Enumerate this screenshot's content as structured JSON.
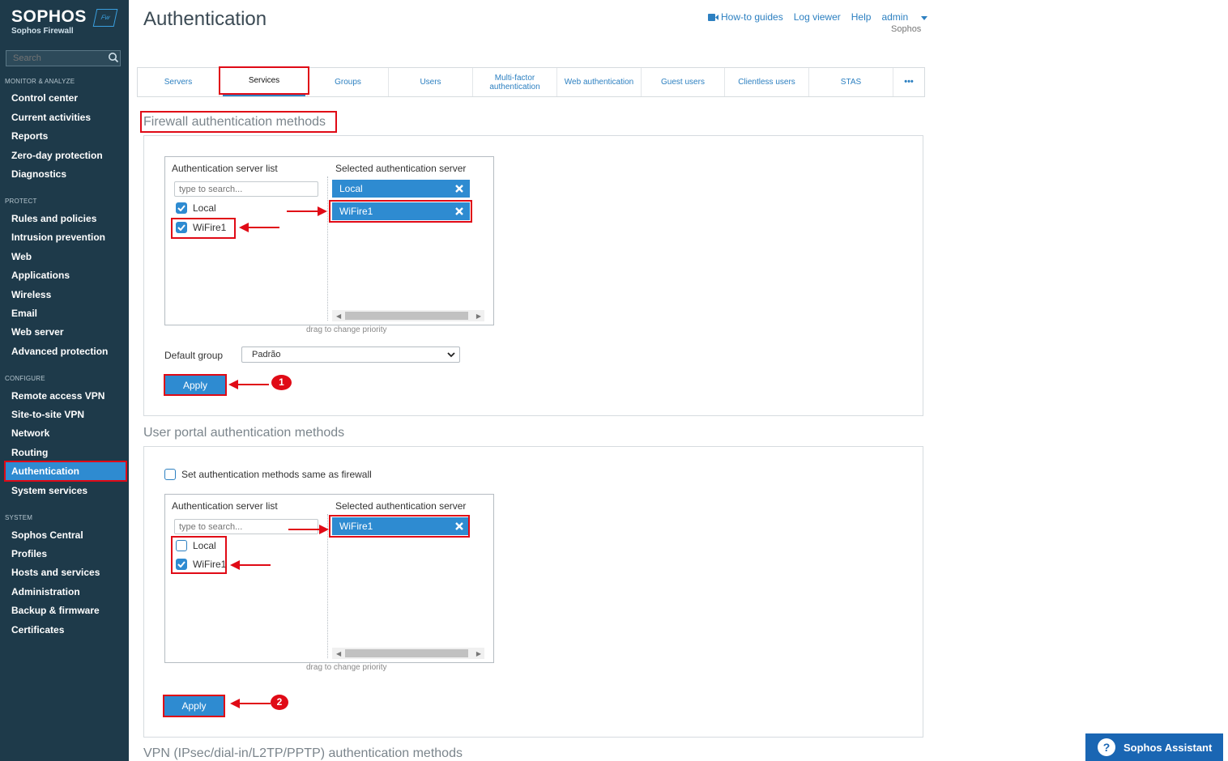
{
  "sidebar": {
    "brand": "SOPHOS",
    "brand_badge": "Fw",
    "product": "Sophos Firewall",
    "search_placeholder": "Search",
    "sections": [
      {
        "title": "MONITOR & ANALYZE",
        "items": [
          "Control center",
          "Current activities",
          "Reports",
          "Zero-day protection",
          "Diagnostics"
        ]
      },
      {
        "title": "PROTECT",
        "items": [
          "Rules and policies",
          "Intrusion prevention",
          "Web",
          "Applications",
          "Wireless",
          "Email",
          "Web server",
          "Advanced protection"
        ]
      },
      {
        "title": "CONFIGURE",
        "items": [
          "Remote access VPN",
          "Site-to-site VPN",
          "Network",
          "Routing",
          "Authentication",
          "System services"
        ]
      },
      {
        "title": "SYSTEM",
        "items": [
          "Sophos Central",
          "Profiles",
          "Hosts and services",
          "Administration",
          "Backup & firmware",
          "Certificates"
        ]
      }
    ],
    "active_item": "Authentication"
  },
  "header": {
    "title": "Authentication",
    "links": {
      "howto": "How-to guides",
      "logviewer": "Log viewer",
      "help": "Help",
      "admin": "admin"
    },
    "admin_org": "Sophos"
  },
  "tabs": [
    {
      "label": "Servers"
    },
    {
      "label": "Services"
    },
    {
      "label": "Groups"
    },
    {
      "label": "Users"
    },
    {
      "label": "Multi-factor authentication"
    },
    {
      "label": "Web authentication"
    },
    {
      "label": "Guest users"
    },
    {
      "label": "Clientless users"
    },
    {
      "label": "STAS"
    },
    {
      "label": "•••"
    }
  ],
  "firewall": {
    "title": "Firewall authentication methods",
    "server_list_title": "Authentication server list",
    "selected_title": "Selected authentication server",
    "search_placeholder": "type to search...",
    "servers": [
      {
        "name": "Local",
        "checked": true
      },
      {
        "name": "WiFire1",
        "checked": true
      }
    ],
    "selected": [
      "Local",
      "WiFire1"
    ],
    "hint": "drag to change priority",
    "default_group_label": "Default group",
    "default_group_value": "Padrão",
    "apply_label": "Apply",
    "step": "1"
  },
  "userportal": {
    "title": "User portal authentication methods",
    "same_as_firewall_label": "Set authentication methods same as firewall",
    "same_as_firewall_checked": false,
    "server_list_title": "Authentication server list",
    "selected_title": "Selected authentication server",
    "search_placeholder": "type to search...",
    "servers": [
      {
        "name": "Local",
        "checked": false
      },
      {
        "name": "WiFire1",
        "checked": true
      }
    ],
    "selected": [
      "WiFire1"
    ],
    "hint": "drag to change priority",
    "apply_label": "Apply",
    "step": "2"
  },
  "vpn": {
    "title": "VPN (IPsec/dial-in/L2TP/PPTP) authentication methods"
  },
  "assistant": {
    "label": "Sophos Assistant",
    "icon_glyph": "?"
  },
  "colors": {
    "sidebar_bg": "#1e3a4a",
    "accent": "#2e8bd1",
    "link": "#2d80c1",
    "highlight_red": "#e00a16"
  }
}
